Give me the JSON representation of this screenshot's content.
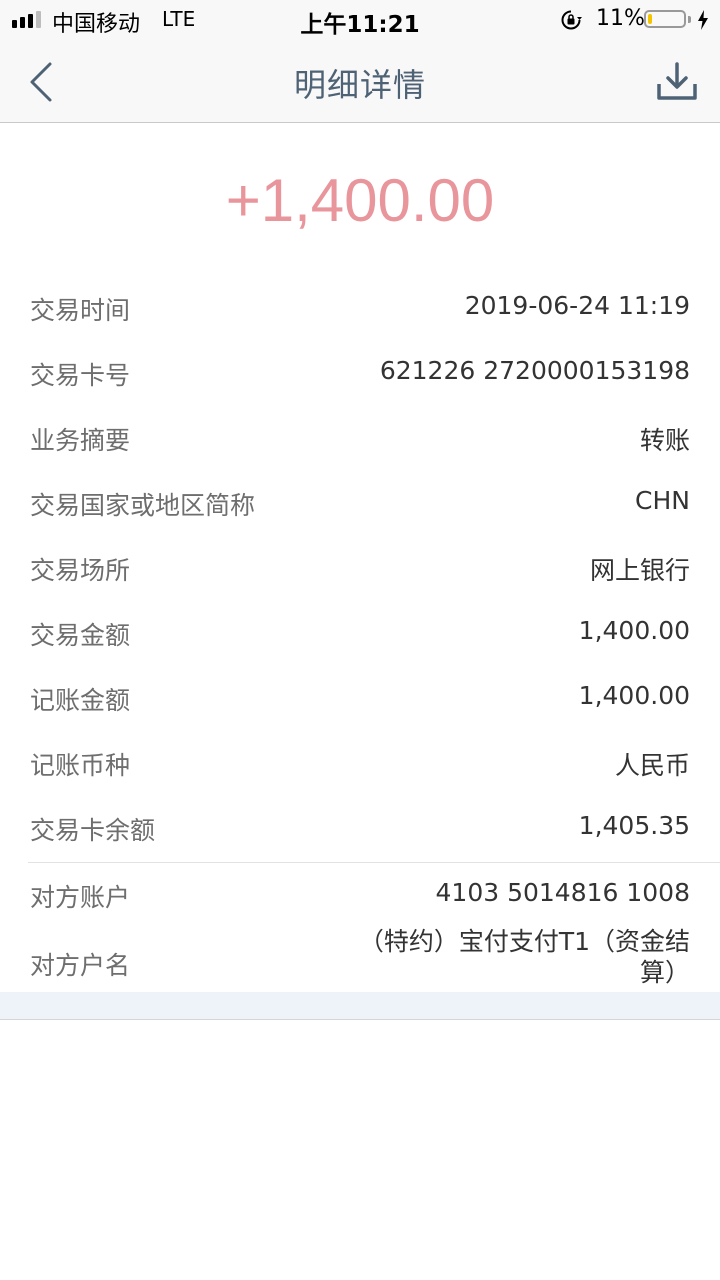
{
  "status_bar": {
    "carrier": "中国移动",
    "network": "LTE",
    "time": "上午11:21",
    "battery_percent": "11%",
    "battery_level": 0.11,
    "signal_bars": 3,
    "signal_bars_total": 4
  },
  "nav": {
    "title": "明细详情"
  },
  "transaction": {
    "amount": "+1,400.00",
    "amount_color": "#e8969c"
  },
  "details": [
    {
      "label": "交易时间",
      "value": "2019-06-24 11:19"
    },
    {
      "label": "交易卡号",
      "value": "621226 2720000153198"
    },
    {
      "label": "业务摘要",
      "value": "转账"
    },
    {
      "label": "交易国家或地区简称",
      "value": "CHN"
    },
    {
      "label": "交易场所",
      "value": "网上银行"
    },
    {
      "label": "交易金额",
      "value": "1,400.00"
    },
    {
      "label": "记账金额",
      "value": "1,400.00"
    },
    {
      "label": "记账币种",
      "value": "人民币"
    },
    {
      "label": "交易卡余额",
      "value": "1,405.35"
    }
  ],
  "counterparty": {
    "account_label": "对方账户",
    "account_value": "4103 5014816 1008",
    "name_label": "对方户名",
    "name_value": "（特约）宝付支付T1（资金结算）"
  },
  "icons": {
    "back": "chevron-left-icon",
    "download": "download-icon",
    "lock": "rotation-lock-icon",
    "charging": "charging-bolt-icon"
  },
  "colors": {
    "title": "#4e6275",
    "label": "#6e6e6e",
    "value": "#333333",
    "footer_band": "#eef2f9"
  }
}
